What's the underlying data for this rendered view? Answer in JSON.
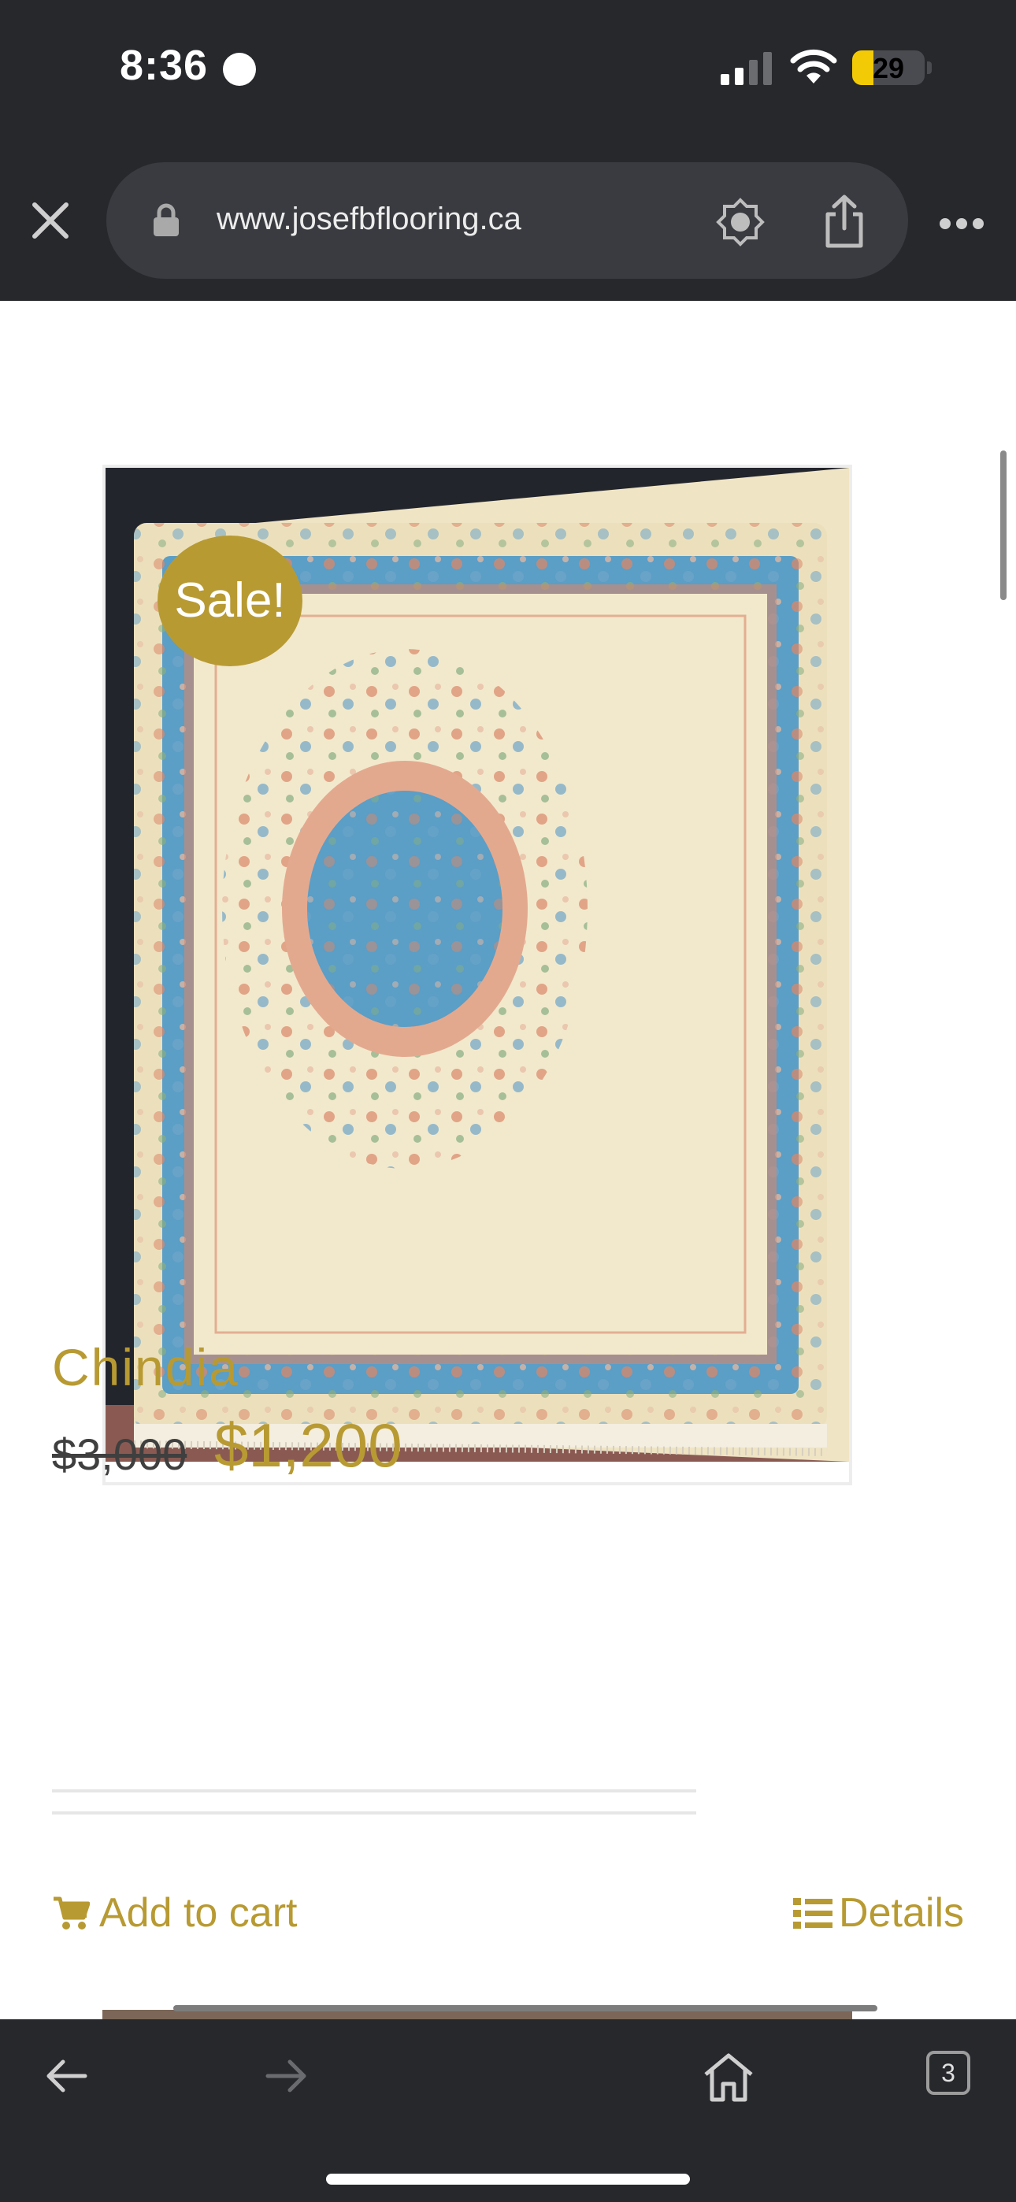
{
  "status_bar": {
    "time": "8:36",
    "battery_level": "29"
  },
  "browser": {
    "url": "www.josefbflooring.ca",
    "tab_count": "3"
  },
  "product": {
    "badge": "Sale!",
    "title": "Chindia",
    "old_price": "$3,000",
    "new_price": "$1,200",
    "add_to_cart": "Add to cart",
    "details": "Details"
  },
  "colors": {
    "accent": "#b89a33",
    "chrome": "#27282c",
    "rug_cream": "#efe4c4",
    "rug_blue": "#5b9ec6",
    "rug_salmon": "#d9876a"
  },
  "icons": [
    "close-icon",
    "lock-icon",
    "reader-icon",
    "share-icon",
    "more-icon",
    "cart-icon",
    "list-icon",
    "back-icon",
    "forward-icon",
    "home-icon"
  ]
}
